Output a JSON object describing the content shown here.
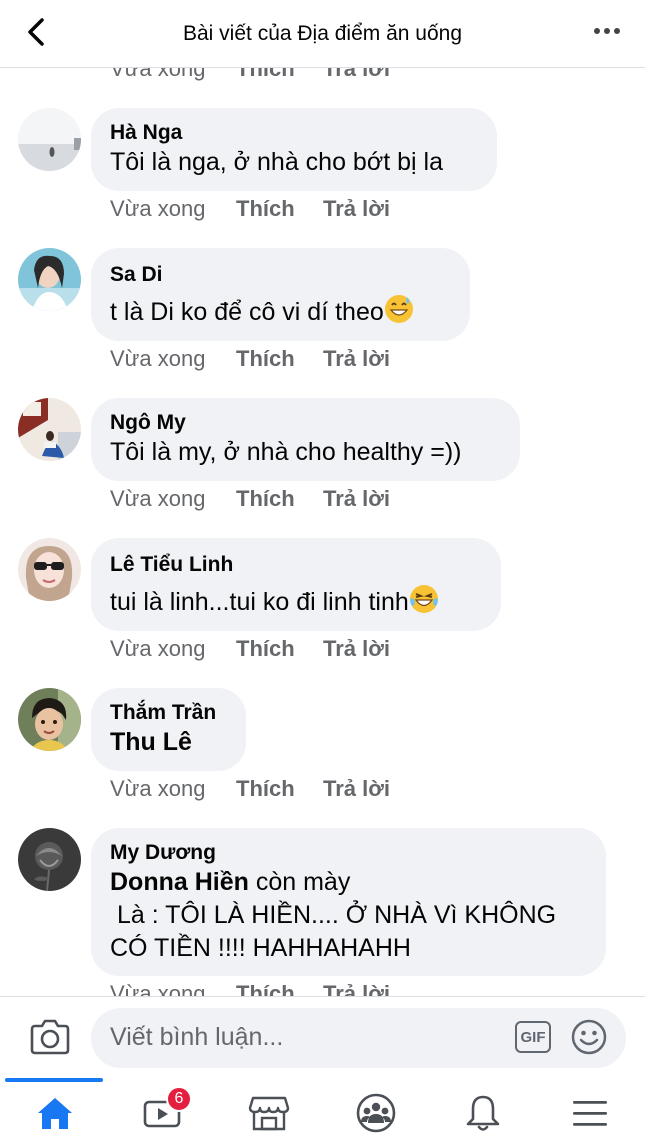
{
  "header": {
    "title": "Bài viết của Địa điểm ăn uống"
  },
  "partial_top": {
    "time": "Vừa xong",
    "like": "Thích",
    "reply": "Trả lời"
  },
  "comments": [
    {
      "name": "Hà Nga",
      "tag": "",
      "text": "Tôi là nga, ở nhà cho bớt bị la",
      "emoji": "",
      "time": "Vừa xong",
      "like": "Thích",
      "reply": "Trả lời"
    },
    {
      "name": "Sa Di",
      "tag": "",
      "text": "t là Di ko để cô vi dí theo",
      "emoji": "grinning-sweat-emoji",
      "time": "Vừa xong",
      "like": "Thích",
      "reply": "Trả lời"
    },
    {
      "name": "Ngô My",
      "tag": "",
      "text": "Tôi là my, ở nhà cho healthy =))",
      "emoji": "",
      "time": "Vừa xong",
      "like": "Thích",
      "reply": "Trả lời"
    },
    {
      "name": "Lê Tiểu Linh",
      "tag": "",
      "text": "tui là linh...tui ko đi linh tinh",
      "emoji": "tears-of-joy-emoji",
      "time": "Vừa xong",
      "like": "Thích",
      "reply": "Trả lời"
    },
    {
      "name": "Thắm Trần",
      "tag": "Thu Lê",
      "text": "",
      "emoji": "",
      "time": "Vừa xong",
      "like": "Thích",
      "reply": "Trả lời"
    },
    {
      "name": "My Dương",
      "tag": "Donna Hiền",
      "text": " còn mày",
      "line2": " Là : TÔI LÀ HIỀN.... Ở NHÀ Vì KHÔNG",
      "line3": "CÓ TIỀN !!!! HAHHAHAHH",
      "emoji": "",
      "time": "Vừa xong",
      "like": "Thích",
      "reply": "Trả lời"
    }
  ],
  "composer": {
    "placeholder": "Viết bình luận...",
    "gif_label": "GIF"
  },
  "tabbar": {
    "active": "home",
    "items": [
      "home-icon",
      "watch-icon",
      "marketplace-icon",
      "groups-icon",
      "notifications-icon",
      "menu-icon"
    ],
    "watch_badge": "6"
  },
  "colors": {
    "accent": "#1877f2",
    "bubble": "#f0f2f5",
    "meta_text": "#65676b",
    "badge": "#e41e3f"
  }
}
